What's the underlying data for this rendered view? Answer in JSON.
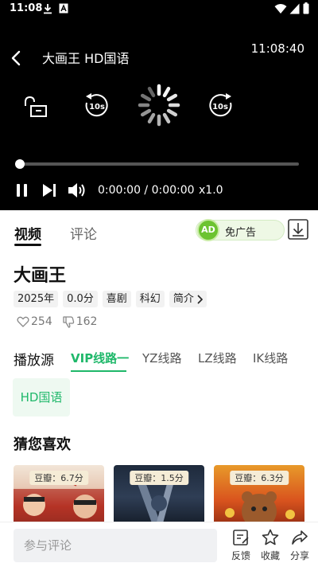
{
  "status_bar": {
    "time": "11:08"
  },
  "player": {
    "title": "大画王 HD国语",
    "clock": "11:08:40",
    "rewind_label": "10s",
    "forward_label": "10s",
    "time_display": "0:00:00 / 0:00:00",
    "speed": "x1.0",
    "progress": 0
  },
  "tabs": {
    "video": "视频",
    "comment": "评论"
  },
  "adfree": {
    "badge": "AD",
    "label": "免广告"
  },
  "movie": {
    "title": "大画王",
    "tags": [
      "2025年",
      "0.0分",
      "喜剧",
      "科幻"
    ],
    "intro_label": "简介",
    "likes": "254",
    "dislikes": "162"
  },
  "source": {
    "label": "播放源",
    "lines": [
      "VIP线路一",
      "YZ线路",
      "LZ线路",
      "IK线路"
    ],
    "active_line": 0,
    "episode": "HD国语"
  },
  "recommendations": {
    "heading": "猜您喜欢",
    "items": [
      {
        "score": "豆瓣：6.7分"
      },
      {
        "score": "豆瓣：1.5分"
      },
      {
        "score": "豆瓣：6.3分"
      }
    ]
  },
  "bottom": {
    "comment_placeholder": "参与评论",
    "feedback": "反馈",
    "favorite": "收藏",
    "share": "分享"
  },
  "colors": {
    "accent": "#1fb86a",
    "adfree_green": "#6cc330",
    "player_bg": "#000000"
  }
}
